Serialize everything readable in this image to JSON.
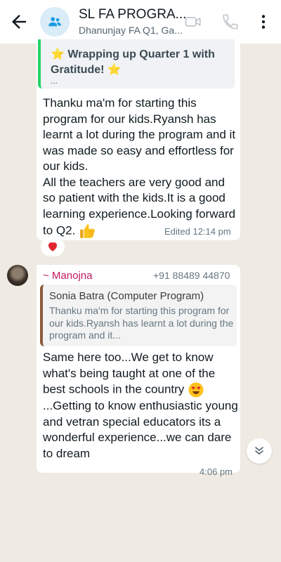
{
  "header": {
    "title": "SL FA PROGRA...",
    "subtitle": "Dhanunjay FA Q1, Ga..."
  },
  "messages": [
    {
      "quote": {
        "text": "⭐ Wrapping up Quarter 1 with Gratitude! ⭐",
        "ellipsis": "..."
      },
      "text": "Thanku ma'm for starting this program for our kids.Ryansh has learnt a lot during the program and it was made so easy and effortless for our kids.\nAll the teachers are very good and so patient with the kids.It is a good learning experience.Looking forward to Q2.",
      "emoji": "thumbs-up",
      "meta": "Edited 12:14 pm",
      "reaction": "heart"
    },
    {
      "sender": "~ Manojna",
      "phone": "+91 88489 44870",
      "quote": {
        "name": "Sonia Batra (Computer Program)",
        "text": "Thanku ma'm for starting this program for our kids.Ryansh has learnt a lot during the program and it..."
      },
      "text_part1": "Same here too...We get to know what's being taught at one of the best schools in the country",
      "emoji": "heart-eyes",
      "text_part2": "...Getting to know enthusiastic young and vetran special educators its a wonderful experience...we can dare to dream",
      "meta": "4:06 pm"
    }
  ],
  "icons": {
    "back": "arrow-left-icon",
    "group": "group-icon",
    "video": "video-call-icon",
    "call": "voice-call-icon",
    "more": "more-vert-icon",
    "scroll": "chevron-double-down-icon"
  },
  "colors": {
    "header_bg": "#ffffff",
    "chat_bg": "#efeae2",
    "bubble_bg": "#ffffff",
    "quote_accent_green": "#25d366",
    "quote_accent_brown": "#8b5a3c",
    "sender_color": "#c2185b"
  }
}
